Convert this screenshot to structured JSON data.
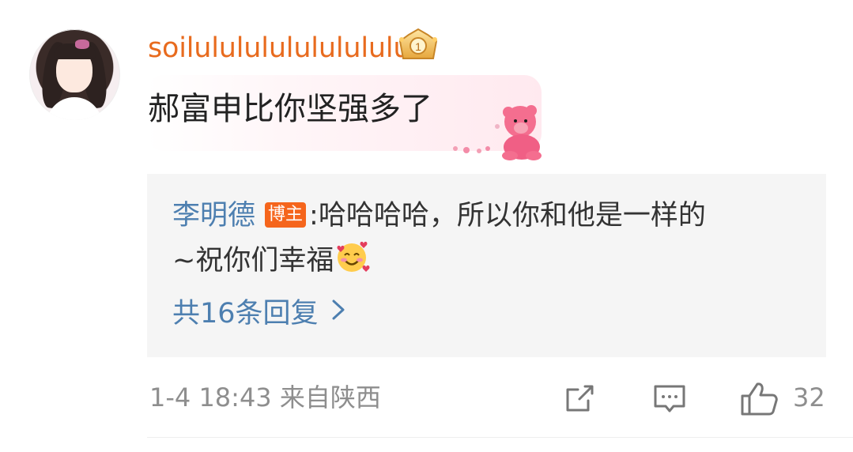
{
  "comment": {
    "username": "soilululululululululu",
    "text": "郝富申比你坚强多了",
    "timestamp": "1-4 18:43",
    "location": "来自陕西",
    "like_count": "32"
  },
  "reply": {
    "author": "李明德",
    "badge": "博主",
    "separator": ":",
    "line1": "哈哈哈哈，所以你和他是一样的",
    "line2": "~祝你们幸福",
    "count_label": "共16条回复"
  },
  "icons": {
    "crown": "crown-badge-icon",
    "emoji": "smiling-face-with-hearts-emoji",
    "chevron": "chevron-right-icon",
    "share": "share-icon",
    "comment": "comment-icon",
    "like": "thumbs-up-icon"
  },
  "colors": {
    "username": "#e86b1e",
    "link": "#4d7fb0",
    "badge": "#f5651c",
    "meta": "#8e8e8e"
  }
}
